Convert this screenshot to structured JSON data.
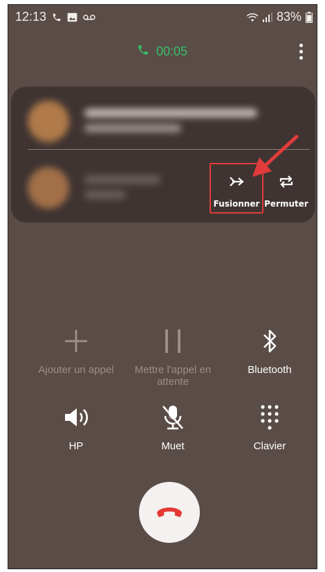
{
  "status_bar": {
    "time": "12:13",
    "battery": "83%",
    "icons": [
      "phone-icon",
      "image-icon",
      "voicemail-icon",
      "wifi-icon",
      "signal-icon",
      "battery-icon"
    ]
  },
  "call": {
    "timer": "00:05",
    "timer_color": "#35c06a",
    "background_color": "#5a4c47"
  },
  "conference": {
    "callers_blurred": true,
    "merge_label": "Fusionner",
    "swap_label": "Permuter",
    "highlight_color": "#e23b3b"
  },
  "controls": {
    "add_call": "Ajouter un appel",
    "hold": "Mettre l'appel en attente",
    "bluetooth": "Bluetooth",
    "speaker": "HP",
    "mute": "Muet",
    "keypad": "Clavier"
  },
  "end_call": {
    "icon": "phone-hangup-icon",
    "color": "#e53935"
  }
}
